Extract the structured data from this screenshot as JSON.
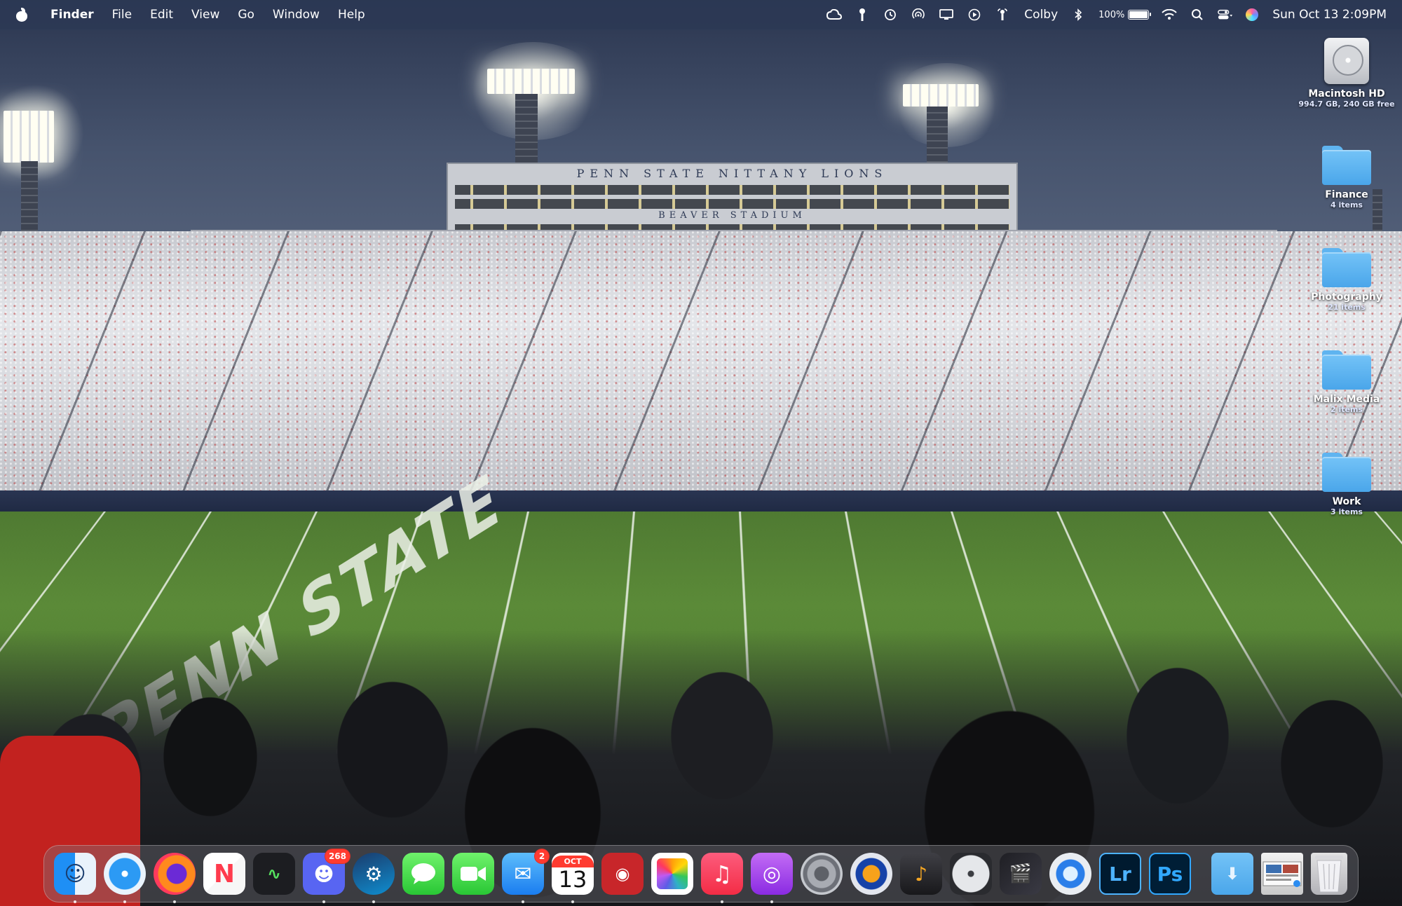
{
  "menubar": {
    "app_name": "Finder",
    "menus": [
      "File",
      "Edit",
      "View",
      "Go",
      "Window",
      "Help"
    ],
    "user": "Colby",
    "battery": {
      "percent_label": "100%",
      "level": 1.0
    },
    "datetime": "Sun Oct 13  2:09PM",
    "status_icons": [
      "creative-cloud-icon",
      "password-key-icon",
      "time-machine-icon",
      "airdrop-icon",
      "display-icon",
      "play-icon",
      "airplay-audio-icon",
      "bluetooth-icon",
      "wifi-icon",
      "spotlight-icon",
      "control-center-icon",
      "siri-icon"
    ]
  },
  "wallpaper": {
    "press_box_sign": "PENN STATE   NITTANY LIONS",
    "stadium_sign": "BEAVER STADIUM",
    "field_text": "PENN STATE"
  },
  "desktop": {
    "icons": [
      {
        "name": "Macintosh HD",
        "sub": "994.7 GB, 240 GB free",
        "icon": "hard-drive-icon"
      },
      {
        "name": "Finance",
        "sub": "4 items",
        "icon": "folder-icon"
      },
      {
        "name": "Photography",
        "sub": "21 items",
        "icon": "folder-icon"
      },
      {
        "name": "Malix Media",
        "sub": "2 items",
        "icon": "folder-icon"
      },
      {
        "name": "Work",
        "sub": "3 items",
        "icon": "folder-icon"
      }
    ]
  },
  "dock": {
    "apps": [
      {
        "name": "Finder",
        "icon": "finder-icon",
        "running": true
      },
      {
        "name": "Safari",
        "icon": "safari-icon",
        "running": true
      },
      {
        "name": "Firefox",
        "icon": "firefox-icon",
        "running": true
      },
      {
        "name": "News",
        "icon": "news-icon",
        "running": false
      },
      {
        "name": "Activity Monitor",
        "icon": "activity-monitor-icon",
        "running": false
      },
      {
        "name": "Discord",
        "icon": "discord-icon",
        "running": true,
        "badge": "268"
      },
      {
        "name": "Steam",
        "icon": "steam-icon",
        "running": true
      },
      {
        "name": "Messages",
        "icon": "messages-icon",
        "running": false
      },
      {
        "name": "FaceTime",
        "icon": "facetime-icon",
        "running": false
      },
      {
        "name": "Mail",
        "icon": "mail-icon",
        "running": true,
        "badge": "2"
      },
      {
        "name": "Calendar",
        "icon": "calendar-icon",
        "running": true,
        "month": "OCT",
        "day": "13"
      },
      {
        "name": "Photo Booth",
        "icon": "photo-booth-icon",
        "running": false
      },
      {
        "name": "Photos",
        "icon": "photos-icon",
        "running": false
      },
      {
        "name": "Music",
        "icon": "music-icon",
        "running": true
      },
      {
        "name": "Podcasts",
        "icon": "podcasts-icon",
        "running": true
      },
      {
        "name": "System Settings",
        "icon": "system-settings-icon",
        "running": false
      },
      {
        "name": "Audacity",
        "icon": "audacity-icon",
        "running": false
      },
      {
        "name": "GarageBand",
        "icon": "garageband-icon",
        "running": false
      },
      {
        "name": "DVD Player",
        "icon": "dvd-player-icon",
        "running": false
      },
      {
        "name": "Final Cut Pro",
        "icon": "final-cut-pro-icon",
        "running": false
      },
      {
        "name": "QuickTime Player",
        "icon": "quicktime-icon",
        "running": false
      },
      {
        "name": "Lightroom",
        "icon": "lightroom-icon",
        "running": false,
        "label": "Lr"
      },
      {
        "name": "Photoshop",
        "icon": "photoshop-icon",
        "running": false,
        "label": "Ps"
      }
    ],
    "stacks": [
      {
        "name": "Downloads",
        "icon": "downloads-folder-icon"
      },
      {
        "name": "Recent Screenshots",
        "icon": "screenshot-stack-icon"
      },
      {
        "name": "Trash",
        "icon": "trash-icon"
      }
    ]
  }
}
